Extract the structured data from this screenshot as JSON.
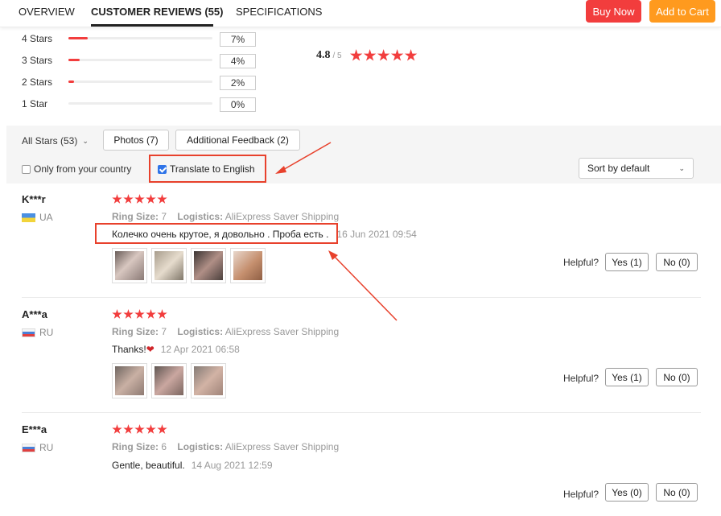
{
  "tabs": [
    {
      "label": "OVERVIEW"
    },
    {
      "label": "CUSTOMER REVIEWS (55)"
    },
    {
      "label": "SPECIFICATIONS"
    }
  ],
  "actions": {
    "buy_now": "Buy Now",
    "add_to_cart": "Add to Cart",
    "buy_color": "#f23d3d",
    "cart_color": "#ff9a1e"
  },
  "rating": {
    "breakdown": [
      {
        "label": "4 Stars",
        "percent": "7%",
        "fraction": 0.07
      },
      {
        "label": "3 Stars",
        "percent": "4%",
        "fraction": 0.04
      },
      {
        "label": "2 Stars",
        "percent": "2%",
        "fraction": 0.02
      },
      {
        "label": "1 Star",
        "percent": "0%",
        "fraction": 0.0
      }
    ],
    "average": "4.8",
    "out_of": "/ 5",
    "stars": 5
  },
  "filters": {
    "all_stars": "All Stars (53)",
    "photos": "Photos (7)",
    "additional_feedback": "Additional Feedback (2)",
    "only_country": "Only from your country",
    "only_country_checked": false,
    "translate": "Translate to English",
    "translate_checked": true,
    "sort": "Sort by default"
  },
  "reviews": [
    {
      "name": "K***r",
      "country": "UA",
      "stars": 5,
      "ring_size_label": "Ring Size:",
      "ring_size": "7",
      "logistics_label": "Logistics:",
      "logistics": "AliExpress Saver Shipping",
      "text": "Колечко очень крутое, я довольно . Проба есть .",
      "date": "16 Jun 2021 09:54",
      "photos": 4,
      "helpful": "Helpful?",
      "yes": "Yes (1)",
      "no": "No (0)"
    },
    {
      "name": "A***a",
      "country": "RU",
      "stars": 5,
      "ring_size_label": "Ring Size:",
      "ring_size": "7",
      "logistics_label": "Logistics:",
      "logistics": "AliExpress Saver Shipping",
      "text": "Thanks!",
      "emoji": "❤",
      "date": "12 Apr 2021 06:58",
      "photos": 3,
      "helpful": "Helpful?",
      "yes": "Yes (1)",
      "no": "No (0)"
    },
    {
      "name": "E***a",
      "country": "RU",
      "stars": 5,
      "ring_size_label": "Ring Size:",
      "ring_size": "6",
      "logistics_label": "Logistics:",
      "logistics": "AliExpress Saver Shipping",
      "text": "Gentle, beautiful.",
      "date": "14 Aug 2021 12:59",
      "photos": 0,
      "helpful": "Helpful?",
      "yes": "Yes (0)",
      "no": "No (0)"
    }
  ],
  "annotation_color": "#e8412c"
}
